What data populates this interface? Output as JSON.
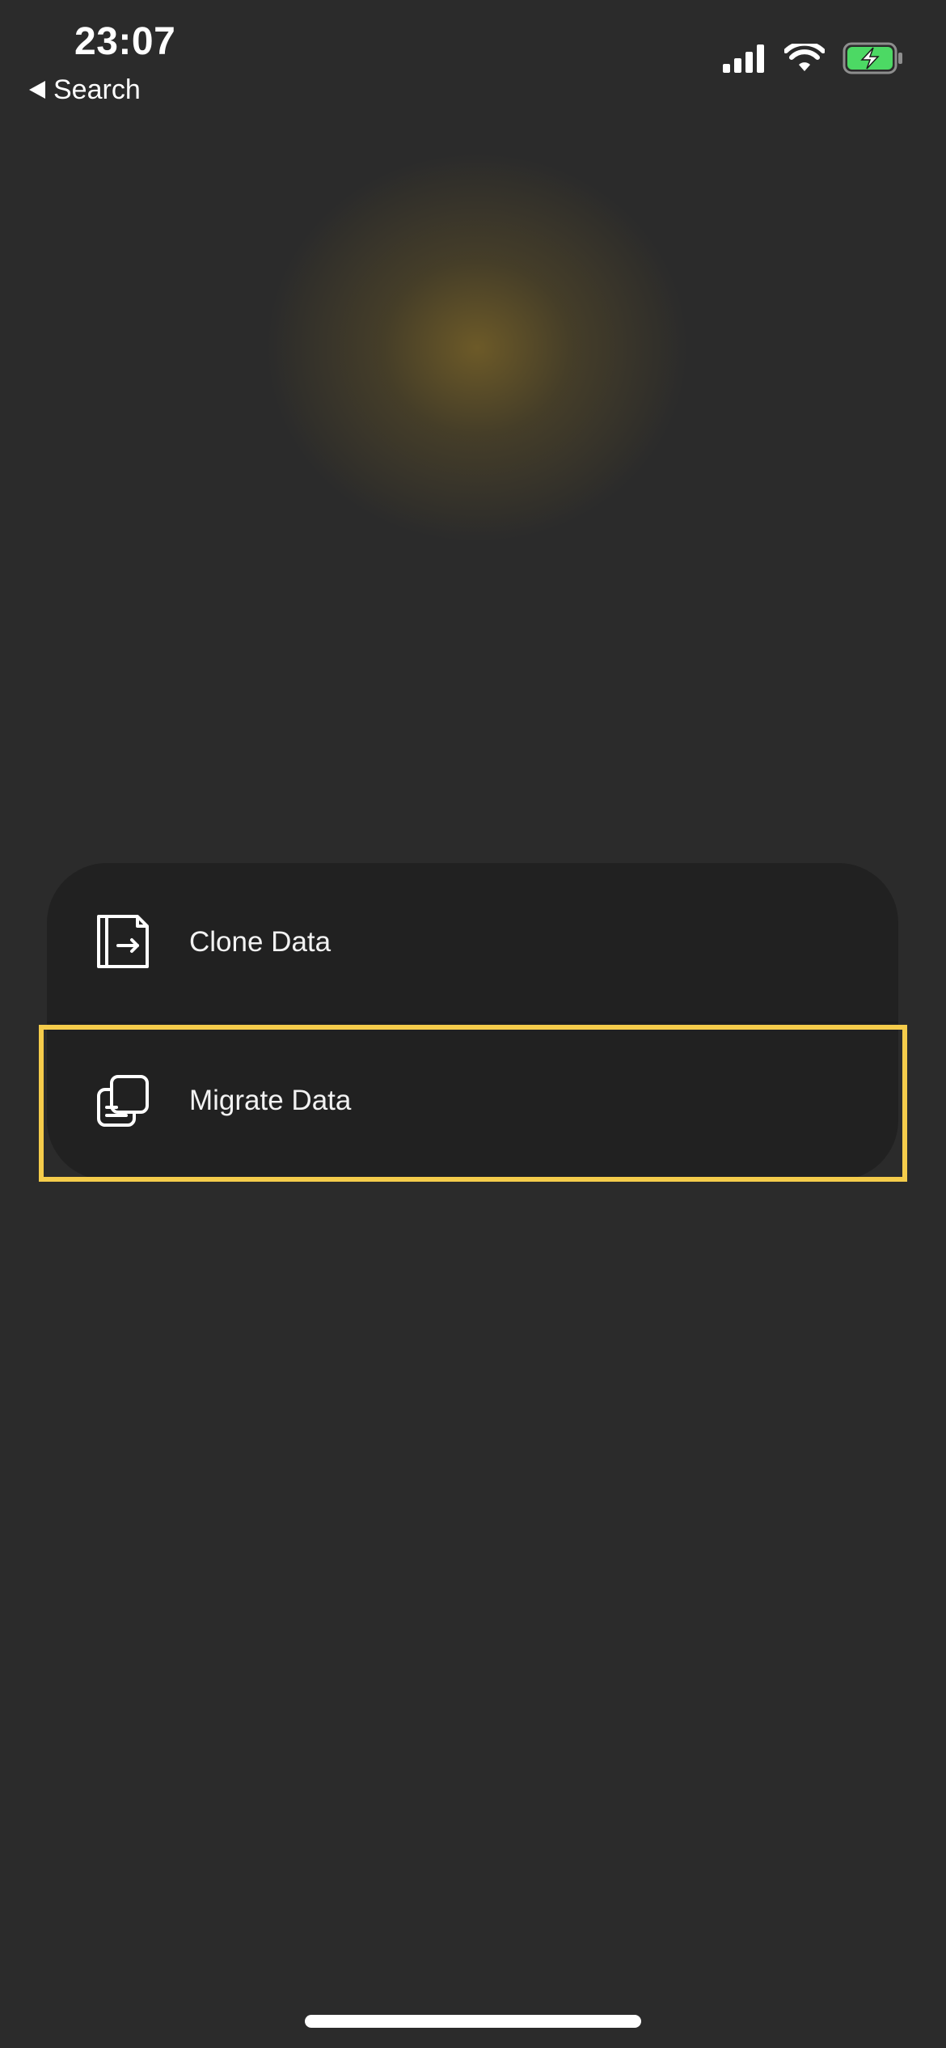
{
  "status_bar": {
    "time": "23:07",
    "back_label": "Search",
    "icons": [
      "signal-icon",
      "wifi-icon",
      "battery-charging-icon"
    ],
    "battery_color": "#4cd964"
  },
  "menu": {
    "items": [
      {
        "label": "Clone Data",
        "icon": "clone-data-icon"
      },
      {
        "label": "Migrate Data",
        "icon": "migrate-data-icon"
      }
    ],
    "highlight_color": "#f5cc4b"
  }
}
